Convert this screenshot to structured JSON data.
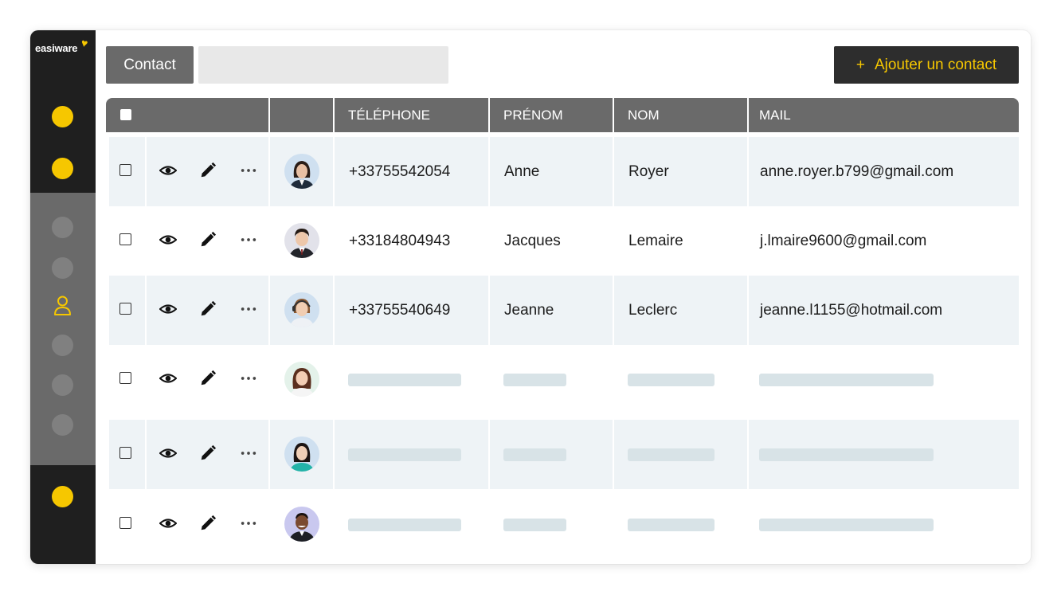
{
  "app": {
    "logo_text": "easiware",
    "accent": "#f6c700"
  },
  "toolbar": {
    "contact_tab": "Contact",
    "add_plus": "+",
    "add_label": "Ajouter un contact"
  },
  "table": {
    "headers": [
      "TÉLÉPHONE",
      "PRÉNOM",
      "NOM",
      "MAIL"
    ],
    "rows": [
      {
        "telephone": "+33755542054",
        "prenom": "Anne",
        "nom": "Royer",
        "mail": "anne.royer.b799@gmail.com"
      },
      {
        "telephone": "+33184804943",
        "prenom": "Jacques",
        "nom": "Lemaire",
        "mail": "j.lmaire9600@gmail.com"
      },
      {
        "telephone": "+33755540649",
        "prenom": "Jeanne",
        "nom": "Leclerc",
        "mail": "jeanne.l1155@hotmail.com"
      }
    ]
  },
  "icons": {
    "view": "eye-icon",
    "edit": "pencil-icon",
    "more": "more-icon",
    "nav_active": "user-icon"
  }
}
